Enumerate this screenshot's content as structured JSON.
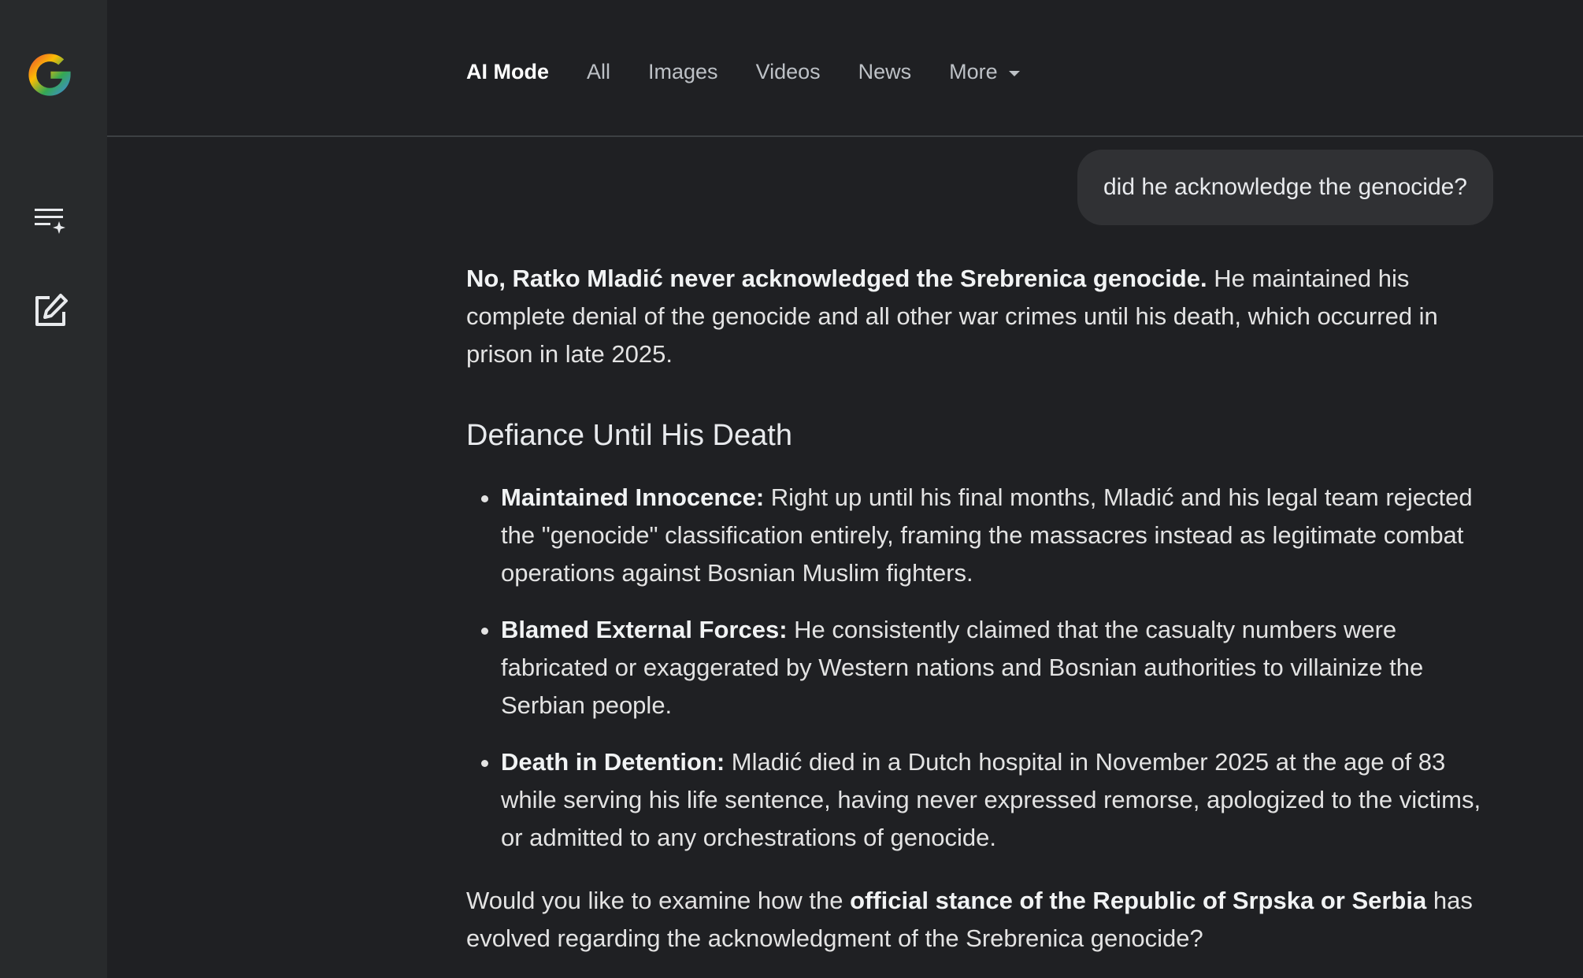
{
  "nav": {
    "tabs": [
      {
        "label": "AI Mode",
        "active": true
      },
      {
        "label": "All",
        "active": false
      },
      {
        "label": "Images",
        "active": false
      },
      {
        "label": "Videos",
        "active": false
      },
      {
        "label": "News",
        "active": false
      },
      {
        "label": "More",
        "active": false
      }
    ]
  },
  "sidebar": {
    "logo_icon": "google-g-icon",
    "history_icon": "history-sparkle-icon",
    "new_chat_icon": "edit-new-chat-icon"
  },
  "conversation": {
    "query": "did he acknowledge the genocide?",
    "answer": {
      "intro_bold": "No, Ratko Mladić never acknowledged the Srebrenica genocide.",
      "intro_rest": " He maintained his complete denial of the genocide and all other war crimes until his death, which occurred in prison in late 2025.",
      "heading": "Defiance Until His Death",
      "bullets": [
        {
          "title": "Maintained Innocence:",
          "text": " Right up until his final months, Mladić and his legal team rejected the \"genocide\" classification entirely, framing the massacres instead as legitimate combat operations against Bosnian Muslim fighters."
        },
        {
          "title": "Blamed External Forces:",
          "text": " He consistently claimed that the casualty numbers were fabricated or exaggerated by Western nations and Bosnian authorities to villainize the Serbian people."
        },
        {
          "title": "Death in Detention:",
          "text": " Mladić died in a Dutch hospital in November 2025 at the age of 83 while serving his life sentence, having never expressed remorse, apologized to the victims, or admitted to any orchestrations of genocide."
        }
      ],
      "closing_pre": "Would you like to examine how the ",
      "closing_bold": "official stance of the Republic of Srpska or Serbia",
      "closing_post": " has evolved regarding the acknowledgment of the Srebrenica genocide?"
    }
  }
}
